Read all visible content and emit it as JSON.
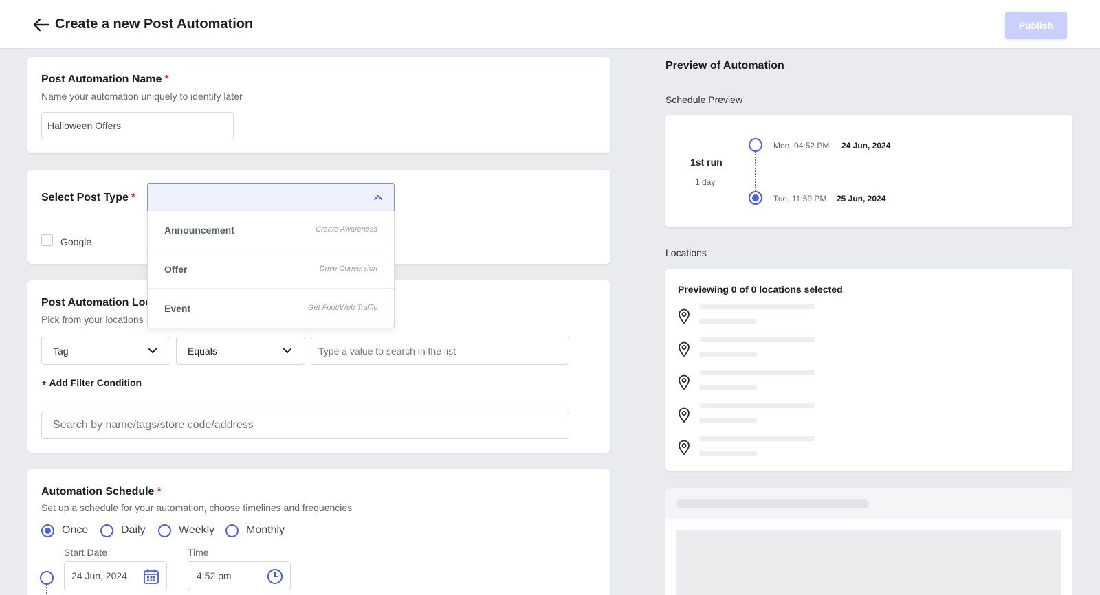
{
  "header": {
    "title": "Create a new Post Automation",
    "publish_label": "Publish"
  },
  "name_section": {
    "title": "Post Automation Name",
    "required_mark": "*",
    "subtitle": "Name your automation uniquely to identify later",
    "input_value": "Halloween Offers"
  },
  "post_type": {
    "title": "Select Post Type",
    "required_mark": "*",
    "checkbox_label": "Google",
    "options": [
      {
        "label": "Announcement",
        "hint": "Create Awareness"
      },
      {
        "label": "Offer",
        "hint": "Drive Conversion"
      },
      {
        "label": "Event",
        "hint": "Get Foot/Web Traffic"
      }
    ]
  },
  "locations_section": {
    "title": "Post Automation Loc",
    "subtitle": "Pick from your locations",
    "filter_field": "Tag",
    "filter_operator": "Equals",
    "value_placeholder": "Type a value to search in the list",
    "add_filter_label": "+ Add Filter Condition",
    "search_placeholder": "Search by name/tags/store code/address"
  },
  "schedule": {
    "title": "Automation Schedule",
    "required_mark": "*",
    "subtitle": "Set up a schedule for your automation, choose timelines and frequencies",
    "options": [
      "Once",
      "Daily",
      "Weekly",
      "Monthly"
    ],
    "selected": "Once",
    "start_date_label": "Start Date",
    "start_date_value": "24 Jun, 2024",
    "time_label": "Time",
    "time_value": "4:52 pm"
  },
  "preview": {
    "title": "Preview of Automation",
    "schedule_label": "Schedule Preview",
    "run_label": "1st run",
    "duration_label": "1 day",
    "start_time": "Mon, 04:52 PM",
    "start_date": "24 Jun, 2024",
    "end_time": "Tue, 11:59 PM",
    "end_date": "25 Jun, 2024",
    "locations_label": "Locations",
    "locations_count_text": "Previewing 0 of 0 locations selected"
  },
  "colors": {
    "accent": "#4a5fe8",
    "publish_disabled": "#c9d0fb",
    "required": "#e0364a",
    "background": "#e9ebee"
  }
}
